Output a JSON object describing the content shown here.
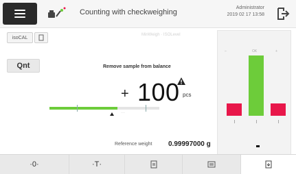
{
  "header": {
    "menu_icon": "hamburger-icon",
    "app_icon": "checkweighing-icon",
    "title": "Counting with checkweighing",
    "user": "Administrator",
    "datetime": "2019 02 17  13:58",
    "logout_icon": "logout-icon"
  },
  "main": {
    "chips": [
      "isoCAL",
      ""
    ],
    "faded_info": "MinWeigh  ·  ISOLevel",
    "mode_button": "Qnt",
    "instruction": "Remove sample from balance",
    "warning_icon": "warning-icon",
    "sign": "+",
    "value": "100",
    "unit": "pcs",
    "progress": {
      "fill_fraction": 0.62,
      "color": "#6dcc3a",
      "label": "···"
    },
    "reference_label": "Reference weight",
    "reference_value": "0.99997000 g"
  },
  "checkweigh_chart": {
    "labels": [
      "–",
      "OK",
      "+"
    ],
    "colors": {
      "under": "#e8174a",
      "ok": "#6dcc3a",
      "over": "#e8174a"
    }
  },
  "toolbar": {
    "buttons": [
      {
        "label": "·0·",
        "icon": "zero-icon"
      },
      {
        "label": "·T·",
        "icon": "tare-icon"
      },
      {
        "label": "",
        "icon": "print-icon"
      },
      {
        "label": "",
        "icon": "data-icon"
      },
      {
        "label": "",
        "icon": "export-icon"
      }
    ]
  }
}
